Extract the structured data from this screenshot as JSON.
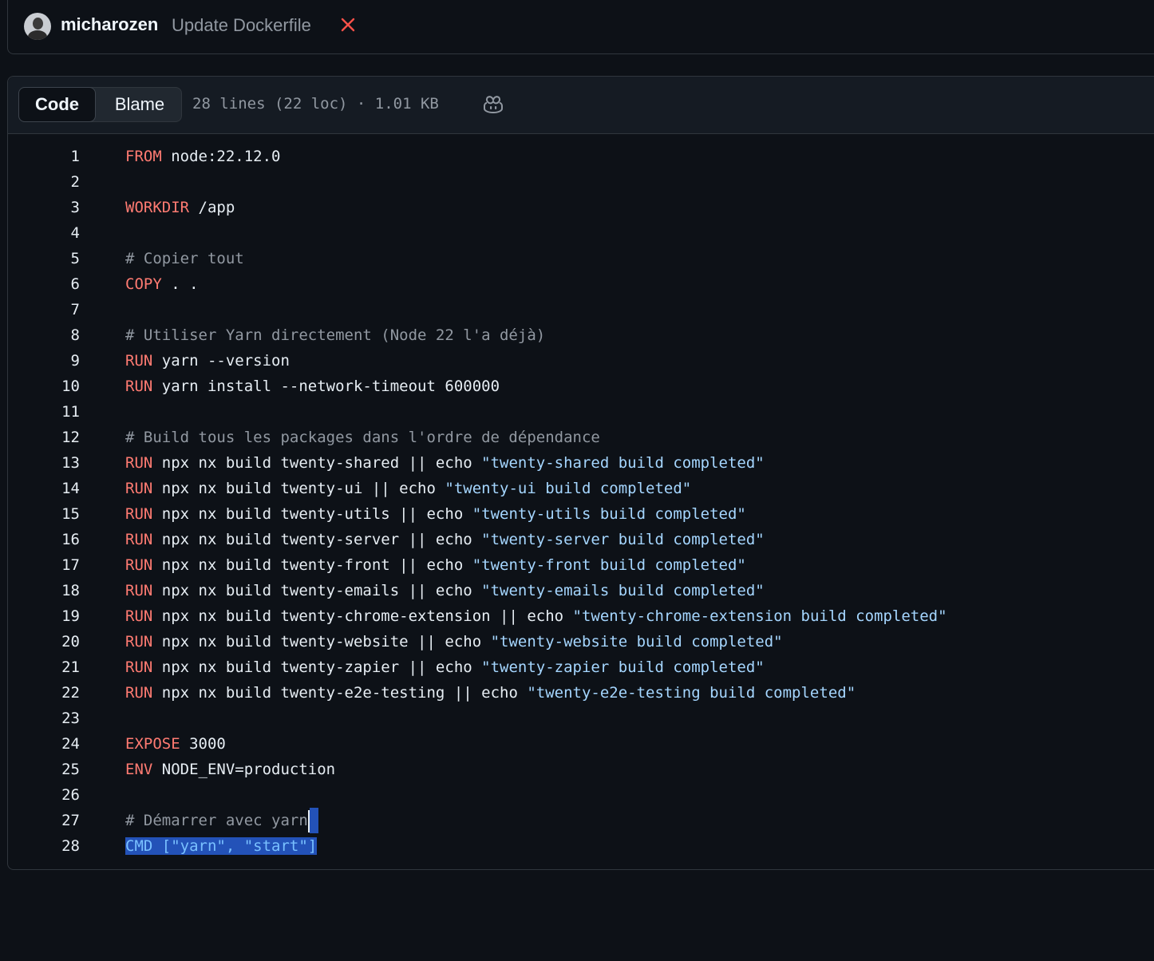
{
  "commit": {
    "author": "micharozen",
    "message": "Update Dockerfile",
    "status_icon": "x-icon",
    "status_color": "#f85149"
  },
  "file_header": {
    "tabs": [
      {
        "label": "Code",
        "active": true
      },
      {
        "label": "Blame",
        "active": false
      }
    ],
    "info": "28 lines (22 loc) · 1.01 KB",
    "copilot_icon": "copilot-icon"
  },
  "colors": {
    "keyword": "#ff7b72",
    "comment": "#9198a1",
    "string": "#a5d6ff",
    "selection": "#2352b8"
  },
  "code": {
    "lines": [
      {
        "n": "1",
        "kw": "FROM",
        "text": " node:22.12.0",
        "str": ""
      },
      {
        "n": "2",
        "kw": "",
        "text": "",
        "str": ""
      },
      {
        "n": "3",
        "kw": "WORKDIR",
        "text": " /app",
        "str": ""
      },
      {
        "n": "4",
        "kw": "",
        "text": "",
        "str": ""
      },
      {
        "n": "5",
        "comment": "# Copier tout"
      },
      {
        "n": "6",
        "kw": "COPY",
        "text": " . .",
        "str": ""
      },
      {
        "n": "7",
        "kw": "",
        "text": "",
        "str": ""
      },
      {
        "n": "8",
        "comment": "# Utiliser Yarn directement (Node 22 l'a déjà)"
      },
      {
        "n": "9",
        "kw": "RUN",
        "text": " yarn --version",
        "str": ""
      },
      {
        "n": "10",
        "kw": "RUN",
        "text": " yarn install --network-timeout 600000",
        "str": ""
      },
      {
        "n": "11",
        "kw": "",
        "text": "",
        "str": ""
      },
      {
        "n": "12",
        "comment": "# Build tous les packages dans l'ordre de dépendance"
      },
      {
        "n": "13",
        "kw": "RUN",
        "text": " npx nx build twenty-shared || echo ",
        "str": "\"twenty-shared build completed\""
      },
      {
        "n": "14",
        "kw": "RUN",
        "text": " npx nx build twenty-ui || echo ",
        "str": "\"twenty-ui build completed\""
      },
      {
        "n": "15",
        "kw": "RUN",
        "text": " npx nx build twenty-utils || echo ",
        "str": "\"twenty-utils build completed\""
      },
      {
        "n": "16",
        "kw": "RUN",
        "text": " npx nx build twenty-server || echo ",
        "str": "\"twenty-server build completed\""
      },
      {
        "n": "17",
        "kw": "RUN",
        "text": " npx nx build twenty-front || echo ",
        "str": "\"twenty-front build completed\""
      },
      {
        "n": "18",
        "kw": "RUN",
        "text": " npx nx build twenty-emails || echo ",
        "str": "\"twenty-emails build completed\""
      },
      {
        "n": "19",
        "kw": "RUN",
        "text": " npx nx build twenty-chrome-extension || echo ",
        "str": "\"twenty-chrome-extension build completed\""
      },
      {
        "n": "20",
        "kw": "RUN",
        "text": " npx nx build twenty-website || echo ",
        "str": "\"twenty-website build completed\""
      },
      {
        "n": "21",
        "kw": "RUN",
        "text": " npx nx build twenty-zapier || echo ",
        "str": "\"twenty-zapier build completed\""
      },
      {
        "n": "22",
        "kw": "RUN",
        "text": " npx nx build twenty-e2e-testing || echo ",
        "str": "\"twenty-e2e-testing build completed\""
      },
      {
        "n": "23",
        "kw": "",
        "text": "",
        "str": ""
      },
      {
        "n": "24",
        "kw": "EXPOSE",
        "text": " 3000",
        "str": ""
      },
      {
        "n": "25",
        "kw": "ENV",
        "text": " NODE_ENV=production",
        "str": ""
      },
      {
        "n": "26",
        "kw": "",
        "text": "",
        "str": ""
      },
      {
        "n": "27",
        "comment": "# Démarrer avec yarn",
        "caret": true
      },
      {
        "n": "28",
        "selected": "CMD [\"yarn\", \"start\"]"
      }
    ]
  }
}
